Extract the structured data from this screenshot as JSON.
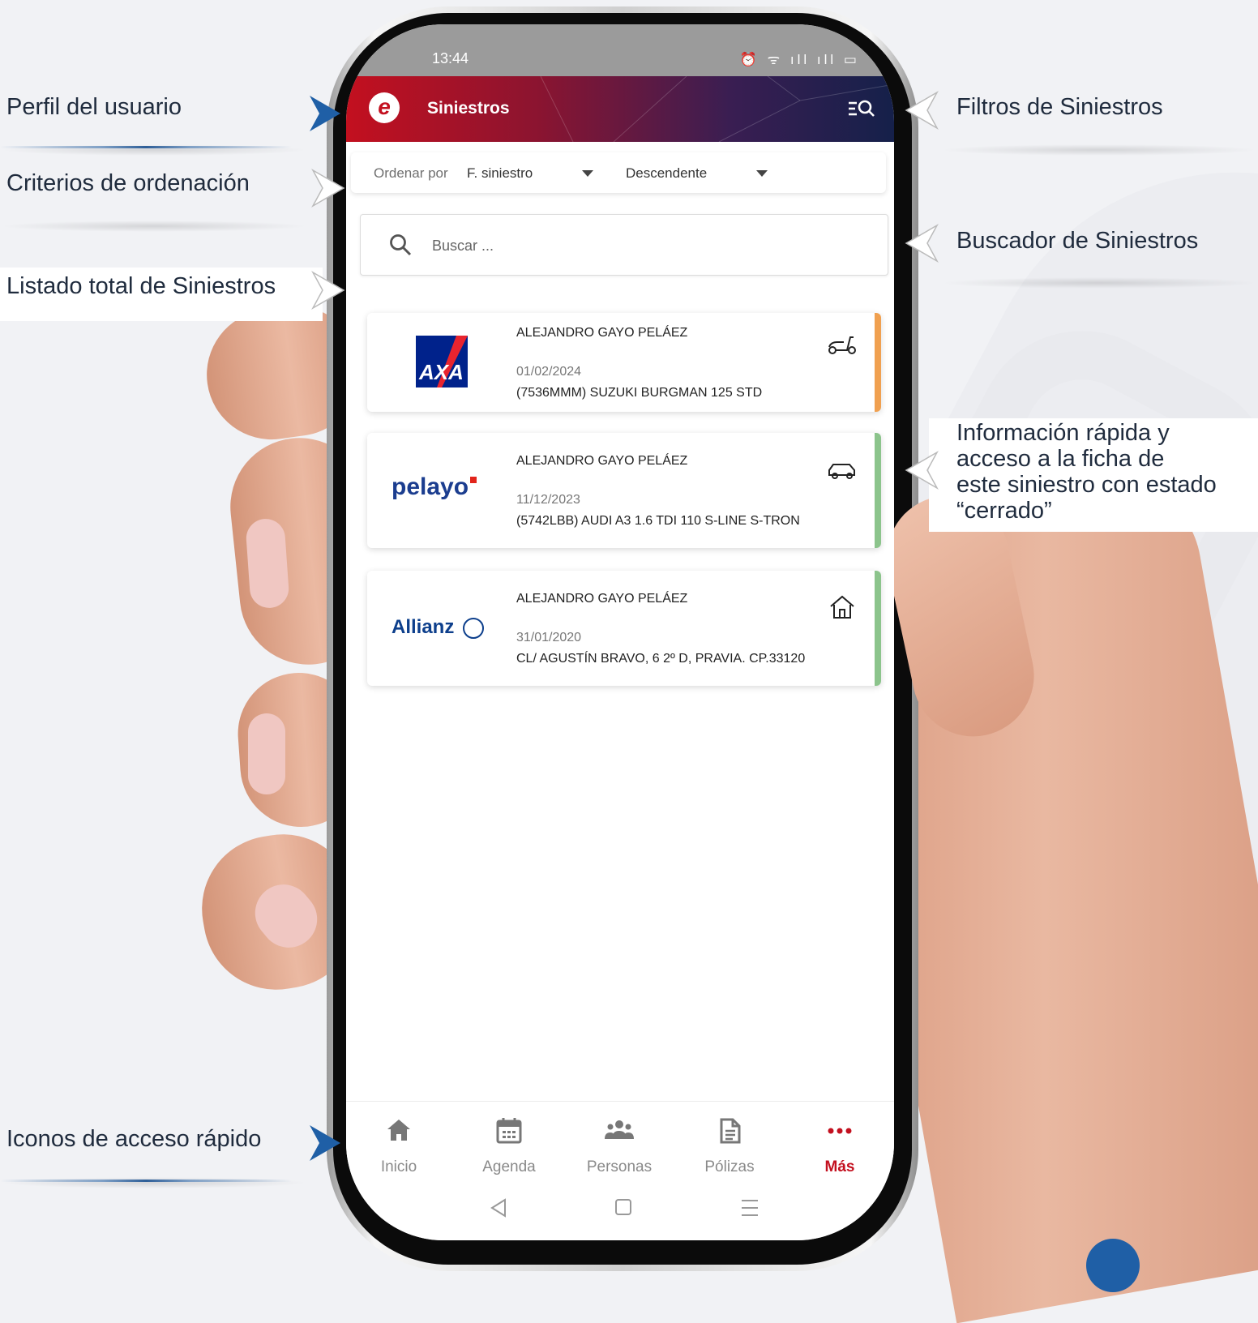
{
  "annotations": {
    "perfil": "Perfil del usuario",
    "criterios": "Criterios de ordenación",
    "listado": "Listado total de Siniestros",
    "iconos": "Iconos de acceso rápido",
    "filtros": "Filtros de Siniestros",
    "buscador": "Buscador de Siniestros",
    "informacion_lines": [
      "Información rápida y",
      "acceso a la ficha de",
      "este siniestro con estado",
      "“cerrado”"
    ]
  },
  "status": {
    "time": "13:44",
    "icons": "⏰ ᯤ ıll ıll ▭"
  },
  "header": {
    "title": "Siniestros",
    "logo_letter": "e"
  },
  "sort": {
    "label": "Ordenar por",
    "value": "F. siniestro",
    "order": "Descendente"
  },
  "search": {
    "placeholder": "Buscar ..."
  },
  "claims": [
    {
      "insurer": "AXA",
      "name": "ALEJANDRO GAYO PELÁEZ",
      "date": "01/02/2024",
      "desc": "(7536MMM) SUZUKI BURGMAN 125 STD",
      "type_icon": "scooter-icon",
      "status_color": "#f0a050"
    },
    {
      "insurer": "pelayo",
      "name": "ALEJANDRO GAYO PELÁEZ",
      "date": "11/12/2023",
      "desc": "(5742LBB) AUDI A3 1.6 TDI 110 S-LINE S-TRON",
      "type_icon": "car-icon",
      "status_color": "#8cc48c"
    },
    {
      "insurer": "Allianz",
      "name": "ALEJANDRO GAYO PELÁEZ",
      "date": "31/01/2020",
      "desc": "CL/ AGUSTÍN BRAVO, 6 2º D, PRAVIA. CP.33120",
      "type_icon": "home-icon",
      "status_color": "#8cc48c"
    }
  ],
  "nav": [
    {
      "label": "Inicio",
      "icon": "home-icon"
    },
    {
      "label": "Agenda",
      "icon": "calendar-icon"
    },
    {
      "label": "Personas",
      "icon": "people-icon"
    },
    {
      "label": "Pólizas",
      "icon": "document-icon"
    },
    {
      "label": "Más",
      "icon": "more-icon",
      "active": true
    }
  ],
  "colors": {
    "brand": "#c3101f",
    "accent_blue": "#1f5fa6"
  }
}
